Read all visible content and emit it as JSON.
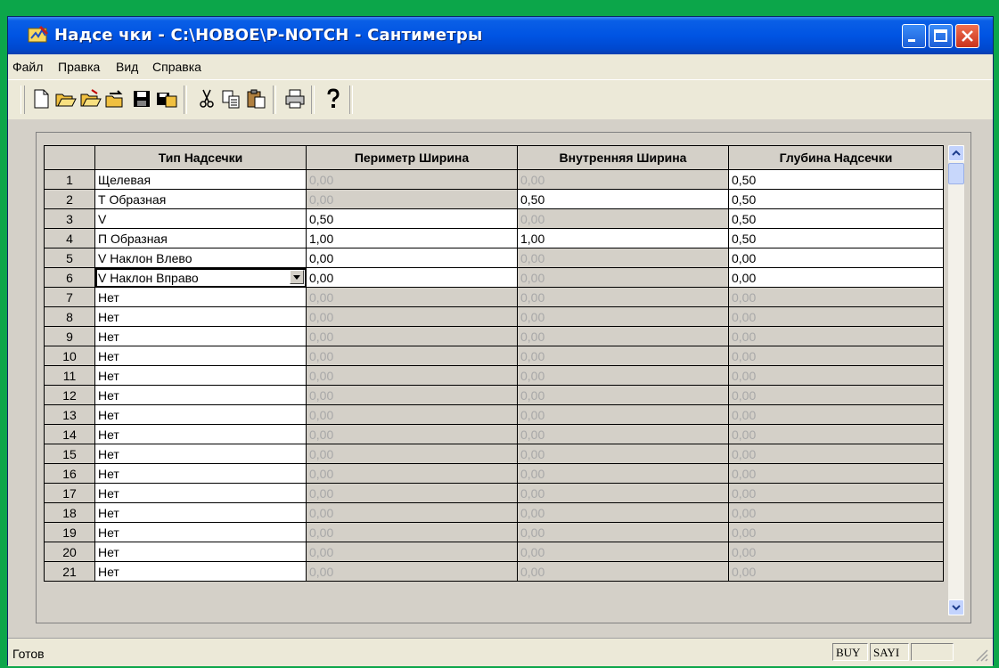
{
  "window": {
    "title": "Надсе чки - С:\\НОВОЕ\\Р-NOTCH - Сантиметры"
  },
  "menu": [
    "Файл",
    "Правка",
    "Вид",
    "Справка"
  ],
  "toolbar_icons": [
    "new-file-icon",
    "open-icon",
    "open-alt-icon",
    "import-icon",
    "save-icon",
    "save-as-icon",
    "cut-icon",
    "copy-icon",
    "paste-icon",
    "print-icon",
    "help-icon"
  ],
  "grid": {
    "columns": [
      "",
      "Тип Надсечки",
      "Периметр Ширина",
      "Внутренняя Ширина",
      "Глубина Надсечки"
    ],
    "rows": [
      {
        "n": "1",
        "type": "Щелевая",
        "perimeter": "0,00",
        "perimeter_enabled": false,
        "inner": "0,00",
        "inner_enabled": false,
        "depth": "0,50",
        "depth_enabled": true
      },
      {
        "n": "2",
        "type": "Т Образная",
        "perimeter": "0,00",
        "perimeter_enabled": false,
        "inner": "0,50",
        "inner_enabled": true,
        "depth": "0,50",
        "depth_enabled": true
      },
      {
        "n": "3",
        "type": "V",
        "perimeter": "0,50",
        "perimeter_enabled": true,
        "inner": "0,00",
        "inner_enabled": false,
        "depth": "0,50",
        "depth_enabled": true
      },
      {
        "n": "4",
        "type": "П Образная",
        "perimeter": "1,00",
        "perimeter_enabled": true,
        "inner": "1,00",
        "inner_enabled": true,
        "depth": "0,50",
        "depth_enabled": true
      },
      {
        "n": "5",
        "type": "V Наклон Влево",
        "perimeter": "0,00",
        "perimeter_enabled": true,
        "inner": "0,00",
        "inner_enabled": false,
        "depth": "0,00",
        "depth_enabled": true
      },
      {
        "n": "6",
        "type": "V Наклон Вправо",
        "perimeter": "0,00",
        "perimeter_enabled": true,
        "inner": "0,00",
        "inner_enabled": false,
        "depth": "0,00",
        "depth_enabled": true,
        "selected": true
      },
      {
        "n": "7",
        "type": "Нет",
        "perimeter": "0,00",
        "perimeter_enabled": false,
        "inner": "0,00",
        "inner_enabled": false,
        "depth": "0,00",
        "depth_enabled": false
      },
      {
        "n": "8",
        "type": "Нет",
        "perimeter": "0,00",
        "perimeter_enabled": false,
        "inner": "0,00",
        "inner_enabled": false,
        "depth": "0,00",
        "depth_enabled": false
      },
      {
        "n": "9",
        "type": "Нет",
        "perimeter": "0,00",
        "perimeter_enabled": false,
        "inner": "0,00",
        "inner_enabled": false,
        "depth": "0,00",
        "depth_enabled": false
      },
      {
        "n": "10",
        "type": "Нет",
        "perimeter": "0,00",
        "perimeter_enabled": false,
        "inner": "0,00",
        "inner_enabled": false,
        "depth": "0,00",
        "depth_enabled": false
      },
      {
        "n": "11",
        "type": "Нет",
        "perimeter": "0,00",
        "perimeter_enabled": false,
        "inner": "0,00",
        "inner_enabled": false,
        "depth": "0,00",
        "depth_enabled": false
      },
      {
        "n": "12",
        "type": "Нет",
        "perimeter": "0,00",
        "perimeter_enabled": false,
        "inner": "0,00",
        "inner_enabled": false,
        "depth": "0,00",
        "depth_enabled": false
      },
      {
        "n": "13",
        "type": "Нет",
        "perimeter": "0,00",
        "perimeter_enabled": false,
        "inner": "0,00",
        "inner_enabled": false,
        "depth": "0,00",
        "depth_enabled": false
      },
      {
        "n": "14",
        "type": "Нет",
        "perimeter": "0,00",
        "perimeter_enabled": false,
        "inner": "0,00",
        "inner_enabled": false,
        "depth": "0,00",
        "depth_enabled": false
      },
      {
        "n": "15",
        "type": "Нет",
        "perimeter": "0,00",
        "perimeter_enabled": false,
        "inner": "0,00",
        "inner_enabled": false,
        "depth": "0,00",
        "depth_enabled": false
      },
      {
        "n": "16",
        "type": "Нет",
        "perimeter": "0,00",
        "perimeter_enabled": false,
        "inner": "0,00",
        "inner_enabled": false,
        "depth": "0,00",
        "depth_enabled": false
      },
      {
        "n": "17",
        "type": "Нет",
        "perimeter": "0,00",
        "perimeter_enabled": false,
        "inner": "0,00",
        "inner_enabled": false,
        "depth": "0,00",
        "depth_enabled": false
      },
      {
        "n": "18",
        "type": "Нет",
        "perimeter": "0,00",
        "perimeter_enabled": false,
        "inner": "0,00",
        "inner_enabled": false,
        "depth": "0,00",
        "depth_enabled": false
      },
      {
        "n": "19",
        "type": "Нет",
        "perimeter": "0,00",
        "perimeter_enabled": false,
        "inner": "0,00",
        "inner_enabled": false,
        "depth": "0,00",
        "depth_enabled": false
      },
      {
        "n": "20",
        "type": "Нет",
        "perimeter": "0,00",
        "perimeter_enabled": false,
        "inner": "0,00",
        "inner_enabled": false,
        "depth": "0,00",
        "depth_enabled": false
      },
      {
        "n": "21",
        "type": "Нет",
        "perimeter": "0,00",
        "perimeter_enabled": false,
        "inner": "0,00",
        "inner_enabled": false,
        "depth": "0,00",
        "depth_enabled": false
      }
    ]
  },
  "status": {
    "text": "Готов",
    "panes": [
      "BUY",
      "SAYI",
      ""
    ]
  },
  "colors": {
    "desktop": "#0ca64a",
    "titlebar": "#0054e3",
    "disabled_text": "#a8a8a8"
  }
}
